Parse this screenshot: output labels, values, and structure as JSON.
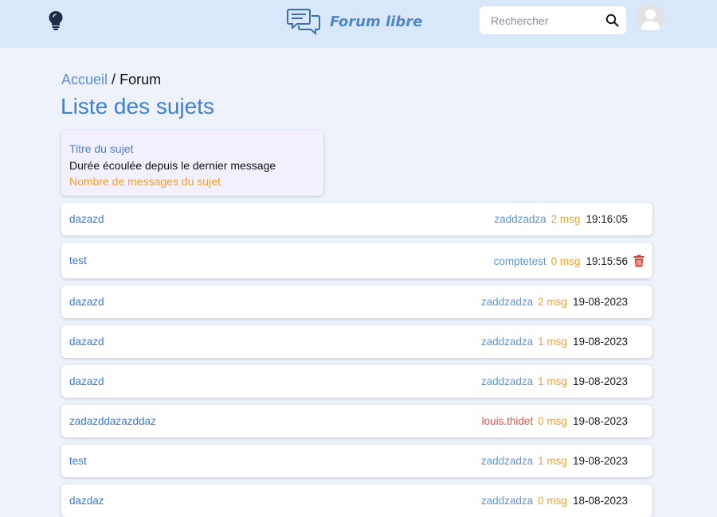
{
  "header": {
    "brand_title": "Forum libre",
    "search_placeholder": "Rechercher",
    "icons": {
      "theme": "lightbulb-icon",
      "brand": "chat-bubbles-icon",
      "search": "search-icon",
      "avatar": "user-avatar-icon"
    }
  },
  "breadcrumb": {
    "home": "Accueil",
    "separator": "/",
    "current": "Forum"
  },
  "page_title": "Liste des sujets",
  "legend": {
    "title_label": "Titre du sujet",
    "duration_label": "Durée écoulée depuis le dernier message",
    "count_label": "Nombre de messages du sujet"
  },
  "colors": {
    "accent": "#3f7fdc",
    "author": "#5a96dd",
    "author_alt": "#e0534a",
    "count": "#f0a030",
    "delete": "#d9412f"
  },
  "topics": [
    {
      "title": "dazazd",
      "author": "zaddzadza",
      "count": "2 msg",
      "time": "19:16:05"
    },
    {
      "title": "test",
      "author": "comptetest",
      "count": "0 msg",
      "time": "19:15:56",
      "delete_icon": "trash-icon"
    },
    {
      "title": "dazazd",
      "author": "zaddzadza",
      "count": "2 msg",
      "time": "19-08-2023"
    },
    {
      "title": "dazazd",
      "author": "zaddzadza",
      "count": "1 msg",
      "time": "19-08-2023"
    },
    {
      "title": "dazazd",
      "author": "zaddzadza",
      "count": "1 msg",
      "time": "19-08-2023"
    },
    {
      "title": "zadazddazazddaz",
      "author": "louis.thidet",
      "count": "0 msg",
      "time": "19-08-2023"
    },
    {
      "title": "test",
      "author": "zaddzadza",
      "count": "1 msg",
      "time": "19-08-2023"
    },
    {
      "title": "dazdaz",
      "author": "zaddzadza",
      "count": "0 msg",
      "time": "18-08-2023"
    }
  ]
}
